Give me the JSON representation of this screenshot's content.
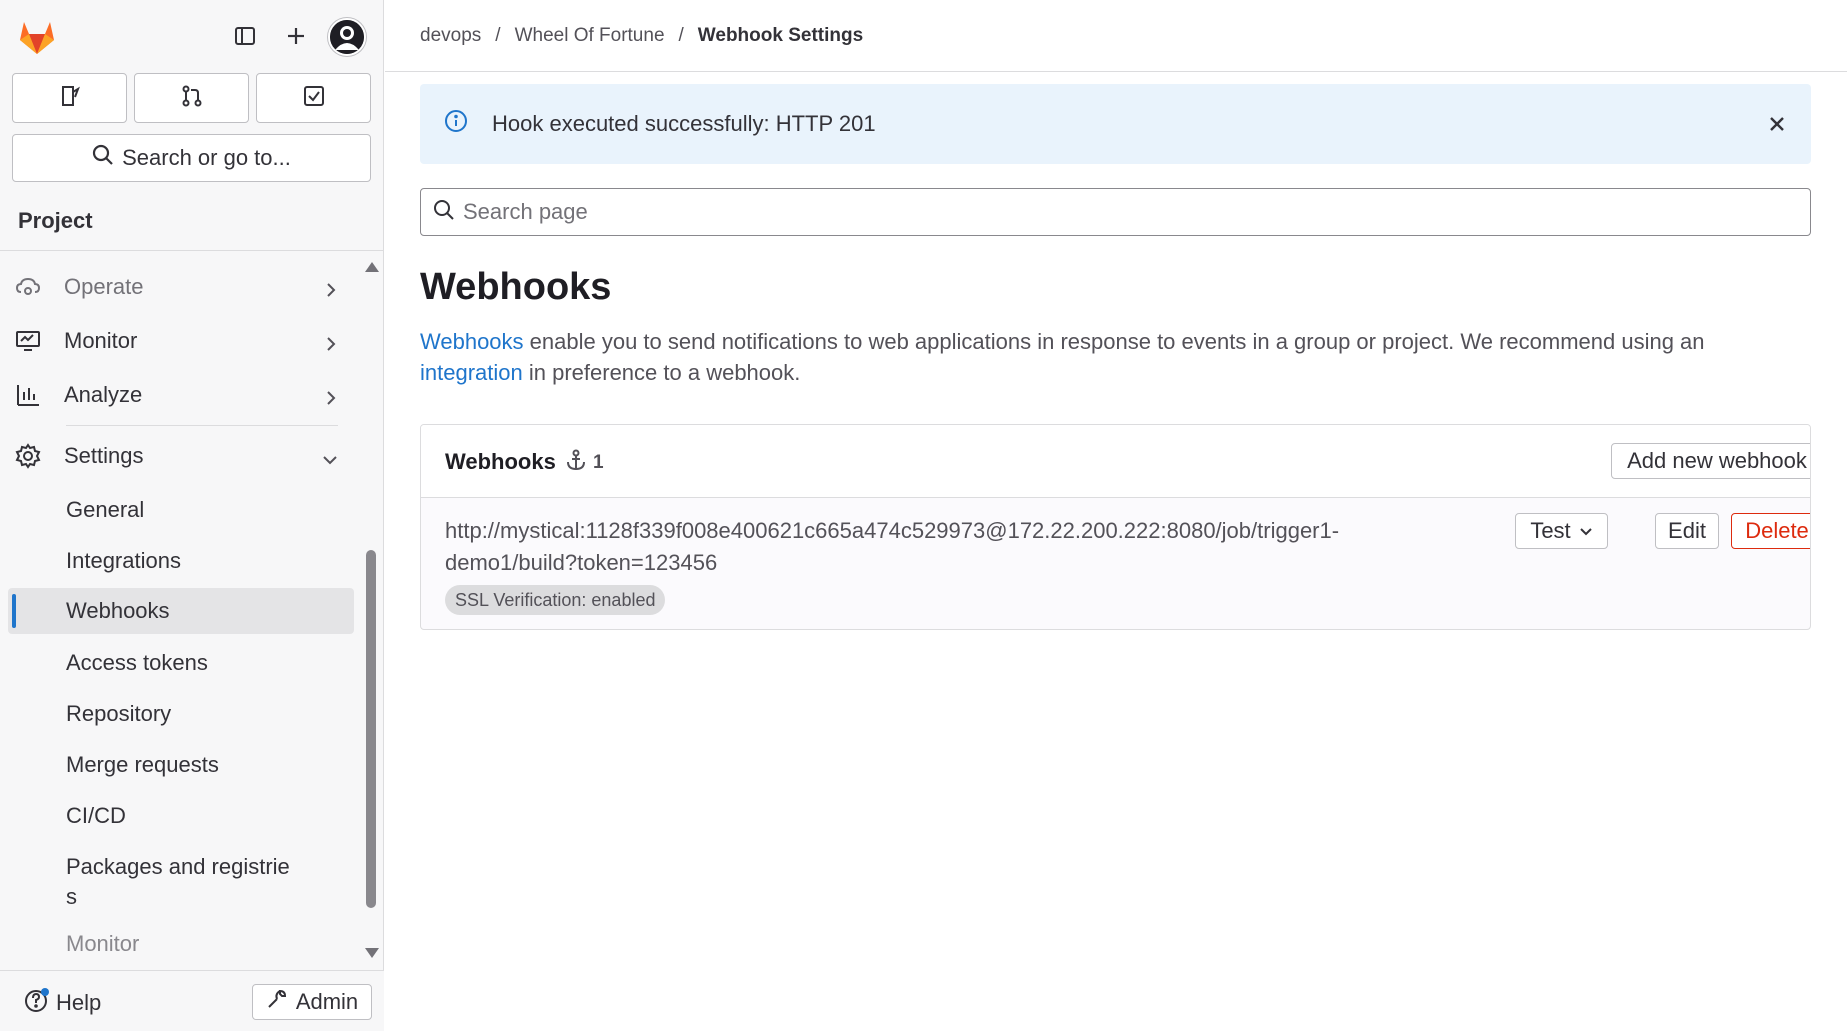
{
  "app": {
    "accent_color": "#1f75cb",
    "logo_icon": "gitlab-tanuki-icon"
  },
  "topbar": {
    "toggle_sidebar_icon": "sidebar-toggle-icon",
    "create_icon": "plus-icon",
    "avatar_icon": "user-avatar"
  },
  "quick_actions": [
    {
      "name": "issues",
      "icon": "issues-icon"
    },
    {
      "name": "merge-requests",
      "icon": "merge-request-icon"
    },
    {
      "name": "todos",
      "icon": "todo-icon"
    }
  ],
  "sidebar": {
    "search_label": "Search or go to...",
    "context_label": "Project",
    "items": [
      {
        "label": "Operate",
        "icon": "operate-icon"
      },
      {
        "label": "Monitor",
        "icon": "monitor-icon"
      },
      {
        "label": "Analyze",
        "icon": "analyze-icon"
      },
      {
        "label": "Settings",
        "icon": "settings-icon"
      }
    ],
    "settings_subitems": [
      "General",
      "Integrations",
      "Webhooks",
      "Access tokens",
      "Repository",
      "Merge requests",
      "CI/CD",
      "Packages and registrie",
      "s",
      "Monitor"
    ],
    "active_subitem": "Webhooks",
    "help_label": "Help",
    "admin_label": "Admin"
  },
  "breadcrumb": {
    "items": [
      "devops",
      "Wheel Of Fortune"
    ],
    "current": "Webhook Settings",
    "separator": "/"
  },
  "alert": {
    "message": "Hook executed successfully: HTTP 201",
    "icon": "info-icon",
    "close_icon": "close-icon",
    "color": "#e9f3fc"
  },
  "page_search": {
    "placeholder": "Search page",
    "value": ""
  },
  "page": {
    "title": "Webhooks",
    "description_link1": "Webhooks",
    "description_text1": " enable you to send notifications to web applications in response to events in a group or project. We recommend using an",
    "description_link2": "integration",
    "description_text2": " in preference to a webhook."
  },
  "webhooks_card": {
    "title": "Webhooks",
    "count_icon": "webhook-anchor-icon",
    "count": "1",
    "add_button": "Add new webhook",
    "hooks": [
      {
        "url_line1": "http://mystical:1128f339f008e400621c665a474c529973@172.22.200.222:8080/job/trigger1-",
        "url_line2": "demo1/build?token=123456",
        "ssl_badge": "SSL Verification: enabled",
        "test_button": "Test",
        "edit_button": "Edit",
        "delete_button": "Delete"
      }
    ]
  }
}
